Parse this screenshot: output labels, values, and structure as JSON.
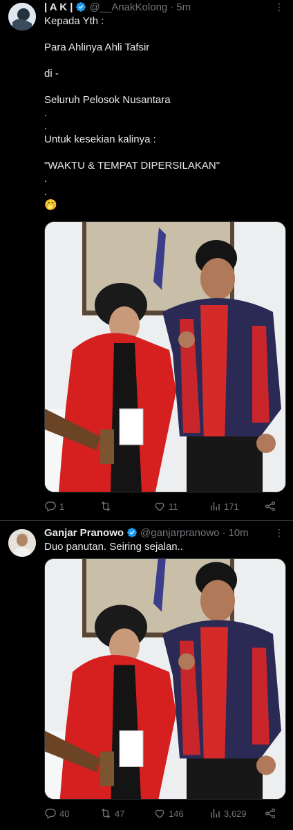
{
  "tweets": [
    {
      "author": "| A K |",
      "handle": "@__AnakKolong",
      "time": "5m",
      "text_lines": [
        "Kepada Yth :",
        "",
        "Para Ahlinya Ahli Tafsir",
        "",
        "di -",
        "",
        "Seluruh Pelosok Nusantara",
        ".",
        ".",
        "Untuk kesekian kalinya :",
        "",
        "\"WAKTU & TEMPAT DIPERSILAKAN\"",
        ".",
        ".",
        "🤭"
      ],
      "stats": {
        "replies": "1",
        "retweets": "",
        "likes": "11",
        "views": "171"
      }
    },
    {
      "author": "Ganjar Pranowo",
      "handle": "@ganjarpranowo",
      "time": "10m",
      "text": "Duo panutan. Seiring sejalan..",
      "stats": {
        "replies": "40",
        "retweets": "47",
        "likes": "146",
        "views": "3,629"
      }
    }
  ],
  "icons": {
    "verified": "verified-badge-icon",
    "more": "more-options-icon",
    "reply": "reply-icon",
    "retweet": "retweet-icon",
    "like": "heart-icon",
    "views": "views-icon",
    "share": "share-icon"
  },
  "colors": {
    "accent": "#1d9bf0",
    "secondary_text": "#71767b",
    "background": "#000000"
  }
}
